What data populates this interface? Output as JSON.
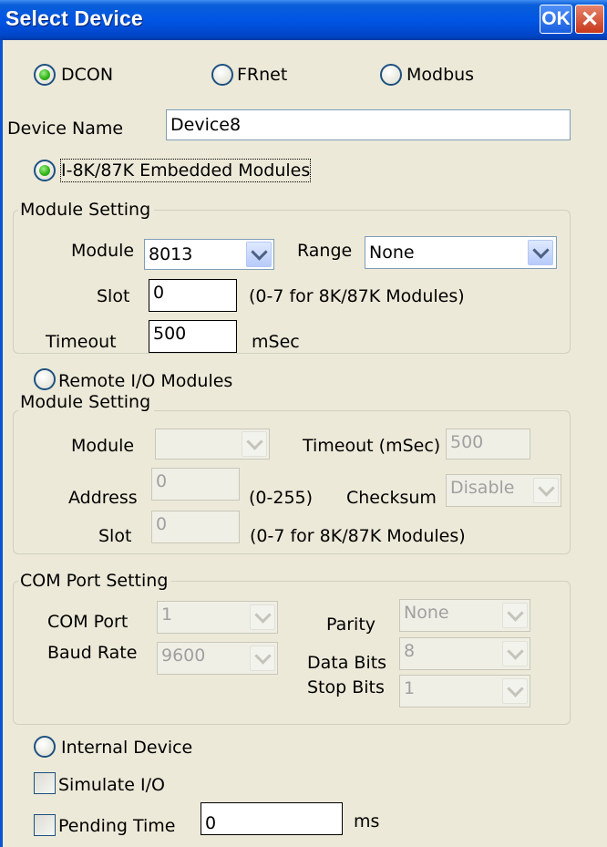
{
  "window": {
    "title": "Select Device",
    "ok_label": "OK",
    "close_glyph": "✕"
  },
  "protocol": {
    "options": [
      {
        "label": "DCON",
        "selected": true
      },
      {
        "label": "FRnet",
        "selected": false
      },
      {
        "label": "Modbus",
        "selected": false
      }
    ]
  },
  "device_name": {
    "label": "Device Name",
    "value": "Device8"
  },
  "embedded": {
    "radio_label": "I-8K/87K Embedded Modules",
    "selected": true,
    "group_title": "Module Setting",
    "module_label": "Module",
    "module_value": "8013",
    "range_label": "Range",
    "range_value": "None",
    "slot_label": "Slot",
    "slot_value": "0",
    "slot_hint": "(0-7 for 8K/87K Modules)",
    "timeout_label": "Timeout",
    "timeout_value": "500",
    "timeout_unit": "mSec"
  },
  "remote": {
    "radio_label": "Remote I/O Modules",
    "selected": false,
    "group_title": "Module Setting",
    "module_label": "Module",
    "module_value": "",
    "timeout_label": "Timeout (mSec)",
    "timeout_value": "500",
    "address_label": "Address",
    "address_value": "0",
    "address_hint": "(0-255)",
    "checksum_label": "Checksum",
    "checksum_value": "Disable",
    "slot_label": "Slot",
    "slot_value": "0",
    "slot_hint": "(0-7 for 8K/87K Modules)"
  },
  "com": {
    "group_title": "COM Port Setting",
    "port_label": "COM Port",
    "port_value": "1",
    "baud_label": "Baud Rate",
    "baud_value": "9600",
    "parity_label": "Parity",
    "parity_value": "None",
    "databits_label": "Data Bits",
    "databits_value": "8",
    "stopbits_label": "Stop Bits",
    "stopbits_value": "1"
  },
  "internal": {
    "radio_label": "Internal Device",
    "selected": false
  },
  "simulate": {
    "label": "Simulate I/O",
    "checked": false
  },
  "pending": {
    "label": "Pending Time",
    "value": "0",
    "unit": "ms",
    "checked": false
  },
  "colors": {
    "titlebar": "#0055e5",
    "window_bg": "#ece9d8",
    "radio_selected": "#35b51a"
  }
}
